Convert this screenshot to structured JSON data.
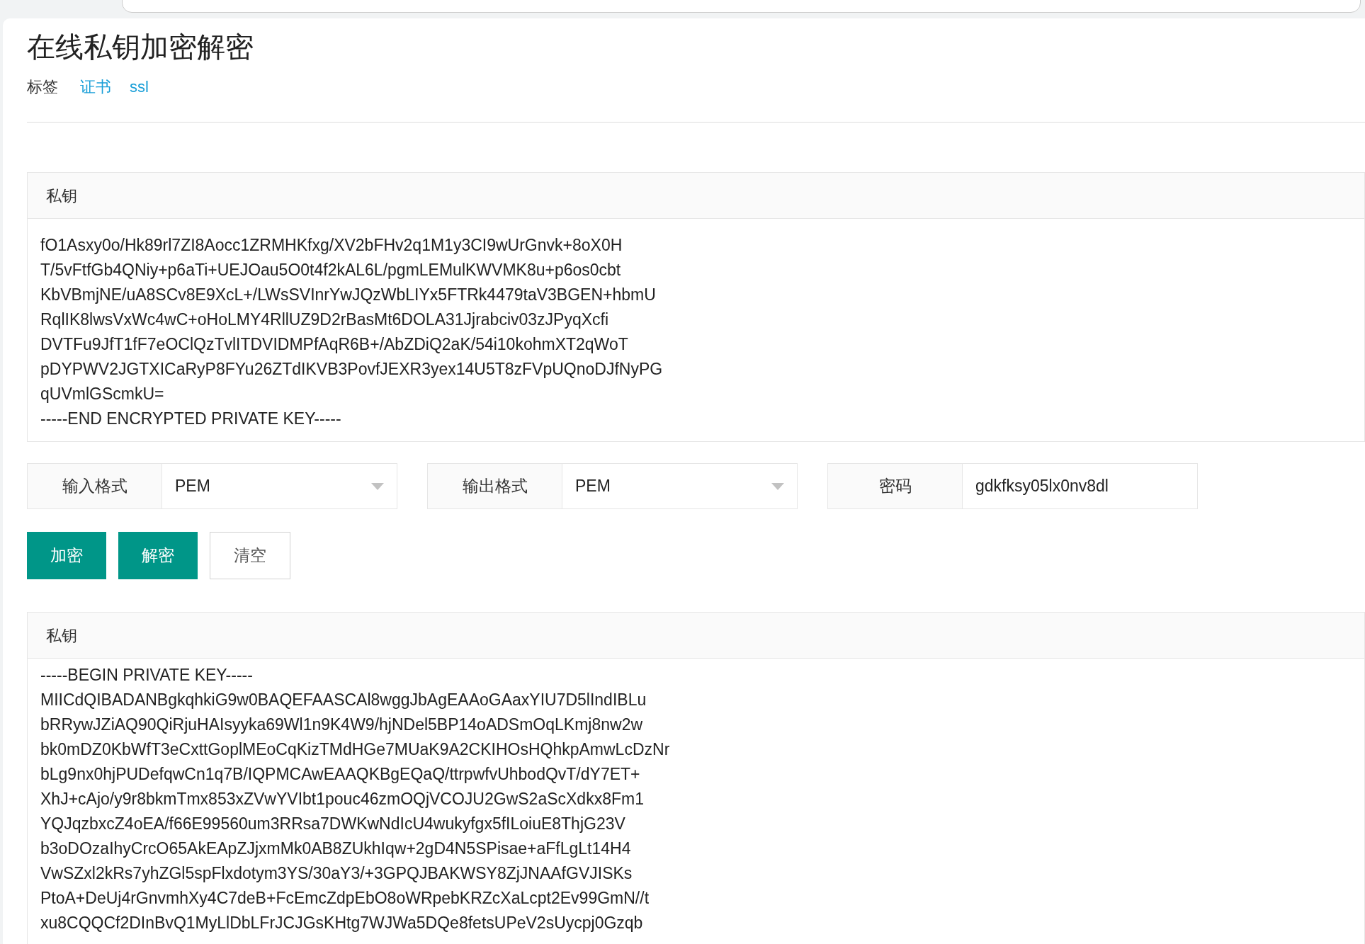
{
  "page": {
    "title": "在线私钥加密解密"
  },
  "tags": {
    "label": "标签",
    "items": [
      "证书",
      "ssl"
    ]
  },
  "input_panel": {
    "title": "私钥",
    "lines": [
      "fO1Asxy0o/Hk89rl7ZI8Aocc1ZRMHKfxg/XV2bFHv2q1M1y3CI9wUrGnvk+8oX0H",
      "T/5vFtfGb4QNiy+p6aTi+UEJOau5O0t4f2kAL6L/pgmLEMulKWVMK8u+p6os0cbt",
      "KbVBmjNE/uA8SCv8E9XcL+/LWsSVInrYwJQzWbLIYx5FTRk4479taV3BGEN+hbmU",
      "RqlIK8lwsVxWc4wC+oHoLMY4RllUZ9D2rBasMt6DOLA31Jjrabciv03zJPyqXcfi",
      "DVTFu9JfT1fF7eOClQzTvlITDVIDMPfAqR6B+/AbZDiQ2aK/54i10kohmXT2qWoT",
      "pDYPWV2JGTXICaRyP8FYu26ZTdIKVB3PovfJEXR3yex14U5T8zFVpUQnoDJfNyPG",
      "qUVmlGScmkU=",
      "-----END ENCRYPTED PRIVATE KEY-----"
    ]
  },
  "options": [
    {
      "kind": "select",
      "label": "输入格式",
      "value": "PEM"
    },
    {
      "kind": "select",
      "label": "输出格式",
      "value": "PEM"
    },
    {
      "kind": "text",
      "label": "密码",
      "value": "gdkfksy05lx0nv8dl"
    }
  ],
  "buttons": [
    {
      "label": "加密",
      "kind": "primary"
    },
    {
      "label": "解密",
      "kind": "primary"
    },
    {
      "label": "清空",
      "kind": "default"
    }
  ],
  "output_panel": {
    "title": "私钥",
    "lines": [
      "-----BEGIN PRIVATE KEY-----",
      "MIICdQIBADANBgkqhkiG9w0BAQEFAASCAl8wggJbAgEAAoGAaxYIU7D5lIndIBLu",
      "bRRywJZiAQ90QiRjuHAIsyyka69Wl1n9K4W9/hjNDel5BP14oADSmOqLKmj8nw2w",
      "bk0mDZ0KbWfT3eCxttGoplMEoCqKizTMdHGe7MUaK9A2CKIHOsHQhkpAmwLcDzNr",
      "bLg9nx0hjPUDefqwCn1q7B/IQPMCAwEAAQKBgEQaQ/ttrpwfvUhbodQvT/dY7ET+",
      "XhJ+cAjo/y9r8bkmTmx853xZVwYVIbt1pouc46zmOQjVCOJU2GwS2aScXdkx8Fm1",
      "YQJqzbxcZ4oEA/f66E99560um3RRsa7DWKwNdIcU4wukyfgx5fILoiuE8ThjG23V",
      "b3oDOzaIhyCrcO65AkEApZJjxmMk0AB8ZUkhIqw+2gD4N5SPisae+aFfLgLt14H4",
      "VwSZxl2kRs7yhZGl5spFlxdotym3YS/30aY3/+3GPQJBAKWSY8ZjJNAAfGVJISKs",
      "PtoA+DeUj4rGnvmhXy4C7deB+FcEmcZdpEbO8oWRpebKRZcXaLcpt2Ev99GmN//t",
      "xu8CQQCf2DInBvQ1MyLlDbLFrJCJGsKHtg7WJWa5DQe8fetsUPeV2sUycpj0Gzqb"
    ]
  }
}
